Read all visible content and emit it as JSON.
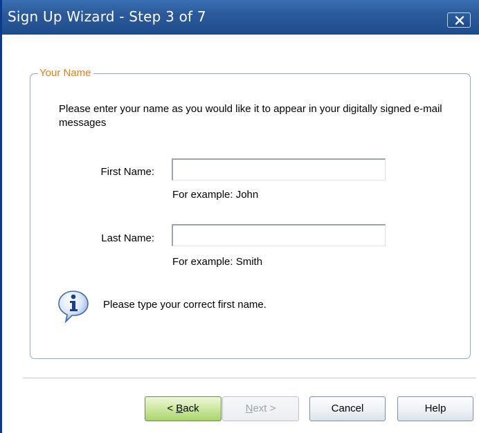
{
  "window": {
    "title": "Sign Up Wizard - Step 3 of 7"
  },
  "group": {
    "legend": "Your Name",
    "instructions": "Please enter your name as you would like it to appear in your digitally signed e-mail messages"
  },
  "form": {
    "first_name": {
      "label": "First Name:",
      "value": "",
      "hint": "For example: John"
    },
    "last_name": {
      "label": "Last Name:",
      "value": "",
      "hint": "For example: Smith"
    }
  },
  "info": {
    "icon": "info-icon",
    "message": "Please type your correct first name."
  },
  "buttons": {
    "back": {
      "prefix": "< ",
      "mnemonic": "B",
      "rest": "ack"
    },
    "next": {
      "mnemonic": "N",
      "rest": "ext >",
      "enabled": false
    },
    "cancel": "Cancel",
    "help": "Help"
  },
  "colors": {
    "titlebar": "#2b5a9c",
    "legend": "#f07c12",
    "groupbox_border": "#90a8c8",
    "default_button": "#a9d467"
  }
}
